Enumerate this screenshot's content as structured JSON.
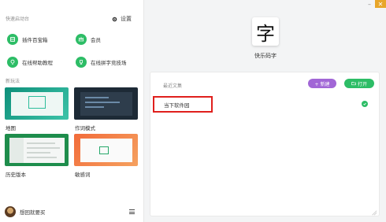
{
  "window": {
    "controls": [
      "minimize",
      "close"
    ]
  },
  "left": {
    "quick_title": "快速启动台",
    "settings_label": "设置",
    "quick_actions": [
      {
        "label": "插件百宝箱",
        "icon": "toolbox-icon"
      },
      {
        "label": "会员",
        "icon": "crown-icon"
      },
      {
        "label": "在线帮助教程",
        "icon": "bulb-icon"
      },
      {
        "label": "在线拼字竞技场",
        "icon": "trophy-icon"
      }
    ],
    "play_title": "新玩法",
    "modes": [
      {
        "label": "地图"
      },
      {
        "label": "作词模式"
      },
      {
        "label": "历史版本"
      },
      {
        "label": "敏感词"
      }
    ],
    "user": {
      "name": "想回就要买"
    }
  },
  "right": {
    "app_logo_char": "字",
    "app_name": "快乐码字",
    "recent_title": "最近文集",
    "new_button": "+ 新建",
    "open_button": "打开",
    "files": [
      {
        "name": "当下软件园",
        "synced": true
      }
    ],
    "accent_new": "#a166d6",
    "accent_open": "#2dbd66",
    "highlight": "#e0201d"
  }
}
